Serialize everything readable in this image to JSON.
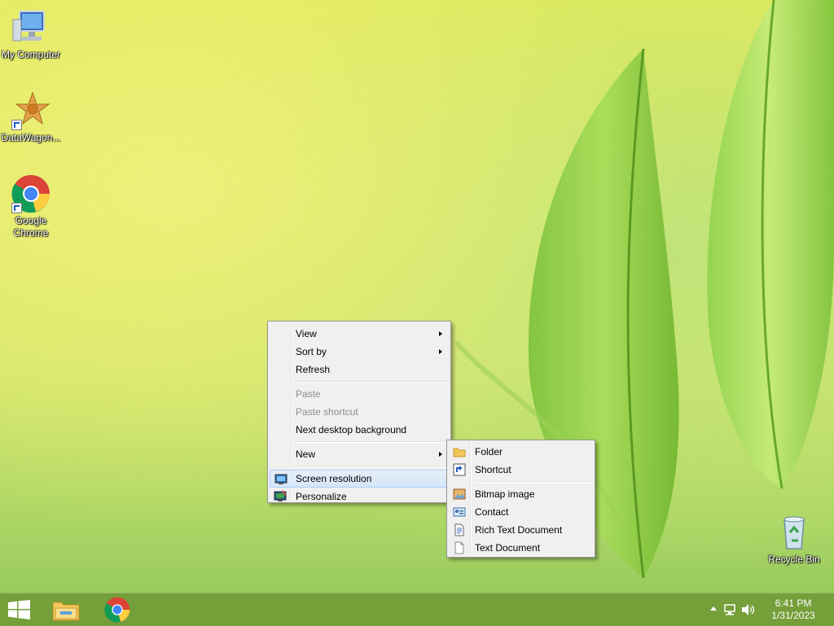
{
  "desktop": {
    "icons": [
      {
        "label": "My Computer",
        "icon": "computer-icon"
      },
      {
        "label": "DataWagon...",
        "icon": "datawagon-icon"
      },
      {
        "label": "Google Chrome",
        "icon": "chrome-icon"
      },
      {
        "label": "Recycle Bin",
        "icon": "recycle-bin-icon"
      }
    ]
  },
  "context_menu": {
    "items": [
      {
        "label": "View",
        "submenu": true
      },
      {
        "label": "Sort by",
        "submenu": true
      },
      {
        "label": "Refresh"
      },
      {
        "label": "Paste",
        "disabled": true
      },
      {
        "label": "Paste shortcut",
        "disabled": true
      },
      {
        "label": "Next desktop background"
      },
      {
        "label": "New",
        "submenu": true
      },
      {
        "label": "Screen resolution",
        "icon": "display-icon",
        "highlighted": true
      },
      {
        "label": "Personalize",
        "icon": "personalize-icon"
      }
    ]
  },
  "new_submenu": {
    "items": [
      {
        "label": "Folder",
        "icon": "folder-icon"
      },
      {
        "label": "Shortcut",
        "icon": "shortcut-icon"
      },
      {
        "label": "Bitmap image",
        "icon": "bitmap-icon"
      },
      {
        "label": "Contact",
        "icon": "contact-icon"
      },
      {
        "label": "Rich Text Document",
        "icon": "rich-text-icon"
      },
      {
        "label": "Text Document",
        "icon": "text-document-icon"
      }
    ]
  },
  "taskbar": {
    "buttons": [
      "start-button",
      "file-explorer-button",
      "chrome-button"
    ],
    "tray_icons": [
      "show-hidden-icons-arrow",
      "network-icon",
      "volume-icon"
    ],
    "clock": {
      "time": "6:41 PM",
      "date": "1/31/2023"
    }
  },
  "colors": {
    "menu_bg": "#f0f0f0",
    "menu_highlight": "#d6e6f8",
    "taskbar": "#6e9632"
  }
}
